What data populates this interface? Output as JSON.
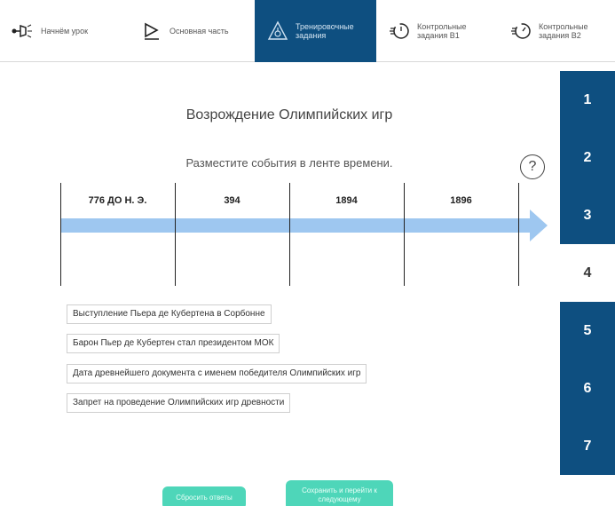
{
  "nav": {
    "tabs": [
      {
        "label": "Начнём урок",
        "icon": "flashlight-icon",
        "active": false
      },
      {
        "label": "Основная часть",
        "icon": "play-icon",
        "active": false
      },
      {
        "label": "Тренировочные\nзадания",
        "icon": "compass-icon",
        "active": true
      },
      {
        "label": "Контрольные\nзадания В1",
        "icon": "timer-icon",
        "active": false
      },
      {
        "label": "Контрольные\nзадания В2",
        "icon": "timer-icon",
        "active": false
      }
    ]
  },
  "sidebar": {
    "items": [
      "1",
      "2",
      "3",
      "4",
      "5",
      "6",
      "7"
    ],
    "active": "4"
  },
  "main": {
    "title": "Возрождение Олимпийских игр",
    "instruction": "Разместите события в ленте времени.",
    "help_symbol": "?",
    "timeline": {
      "labels": [
        "776 ДО Н. Э.",
        "394",
        "1894",
        "1896"
      ]
    },
    "cards": [
      "Выступление Пьера де Кубертена в Сорбонне",
      "Барон Пьер де Кубертен стал президентом МОК",
      "Дата древнейшего документа с именем победителя Олимпийских игр",
      "Запрет на проведение Олимпийских игр древности"
    ],
    "buttons": {
      "reset": "Сбросить ответы",
      "save": "Сохранить и перейти к\nследующему"
    }
  },
  "colors": {
    "accent": "#0e4f80",
    "timeline": "#9ec7f0",
    "button": "#4ed6b9"
  }
}
